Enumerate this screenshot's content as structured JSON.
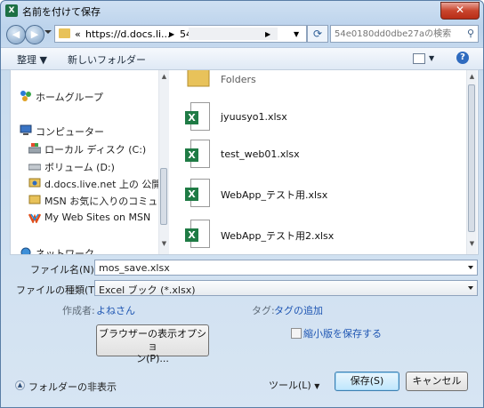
{
  "title": "名前を付けて保存",
  "nav": {
    "path_prefix": "«",
    "path_url": "https://d.docs.li...",
    "path_next": "54",
    "search_placeholder": "54e0180dd0dbe27aの検索"
  },
  "toolbar": {
    "organize": "整理 ▼",
    "new_folder": "新しいフォルダー"
  },
  "sidebar": {
    "items": [
      {
        "label": "ホームグループ",
        "icon": "homegroup-icon"
      },
      {
        "label": "コンピューター",
        "icon": "computer-icon"
      },
      {
        "label": "ローカル ディスク (C:)",
        "icon": "local-disk-icon"
      },
      {
        "label": "ボリューム (D:)",
        "icon": "drive-icon"
      },
      {
        "label": "d.docs.live.net 上の 公開",
        "icon": "network-folder-icon"
      },
      {
        "label": "MSN お気に入りのコミュニテ",
        "icon": "folder-icon"
      },
      {
        "label": "My Web Sites on MSN",
        "icon": "msn-icon"
      },
      {
        "label": "ネットワーク",
        "icon": "network-icon"
      }
    ]
  },
  "files": [
    {
      "name": "Folders",
      "type": "folder"
    },
    {
      "name": "jyuusyo1.xlsx",
      "type": "excel"
    },
    {
      "name": "test_web01.xlsx",
      "type": "excel"
    },
    {
      "name": "WebApp_テスト用.xlsx",
      "type": "excel"
    },
    {
      "name": "WebApp_テスト用2.xlsx",
      "type": "excel"
    }
  ],
  "form": {
    "filename_label": "ファイル名(N):",
    "filename_value": "mos_save.xlsx",
    "filetype_label": "ファイルの種類(T):",
    "filetype_value": "Excel ブック (*.xlsx)",
    "author_label": "作成者:",
    "author_value": "よねさん",
    "tags_label": "タグ:",
    "tags_value": "タグの追加",
    "browser_options_line1": "ブラウザーの表示オプショ",
    "browser_options_line2": "ン(P)...",
    "thumbnail_label": "縮小版を保存する"
  },
  "footer": {
    "hide_folders": "フォルダーの非表示",
    "tools": "ツール(L)",
    "save": "保存(S)",
    "cancel": "キャンセル"
  },
  "colors": {
    "excel_green": "#1f7b45",
    "link_blue": "#1f56b3",
    "close_red": "#c9452d"
  }
}
